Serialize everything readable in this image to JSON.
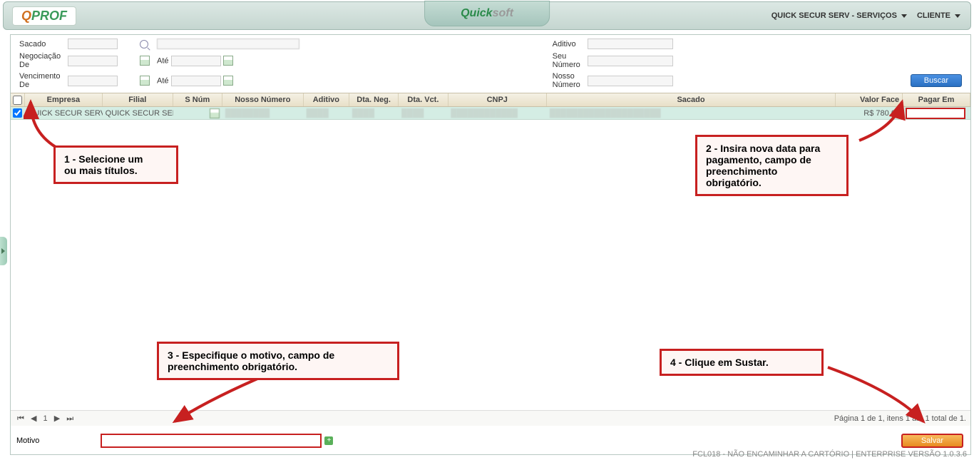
{
  "header": {
    "logo_q": "Q",
    "logo_prof": "PROF",
    "center_1": "Quick",
    "center_2": "soft",
    "right_text": "QUICK SECUR SERV - SERVIÇOS",
    "right_client": "CLIENTE"
  },
  "filters": {
    "sacado": "Sacado",
    "negociacao_de": "Negociação De",
    "vencimento_de": "Vencimento De",
    "ate": "Até",
    "aditivo": "Aditivo",
    "seu_numero": "Seu Número",
    "nosso_numero": "Nosso Número",
    "buscar": "Buscar"
  },
  "grid": {
    "headers": {
      "empresa": "Empresa",
      "filial": "Filial",
      "snum": "S Núm",
      "nosso": "Nosso Número",
      "aditivo": "Aditivo",
      "dta_neg": "Dta. Neg.",
      "dta_vct": "Dta. Vct.",
      "cnpj": "CNPJ",
      "sacado": "Sacado",
      "valor_face": "Valor Face",
      "pagar_em": "Pagar Em"
    },
    "row": {
      "empresa": "QUICK SECUR SERV",
      "filial": "QUICK SECUR SERV",
      "valor": "R$ 780,00"
    }
  },
  "callouts": {
    "c1a": "1 - Selecione um",
    "c1b": "ou mais títulos.",
    "c2a": "2 - Insira nova data para",
    "c2b": "pagamento, campo de",
    "c2c": "preenchimento",
    "c2d": "obrigatório.",
    "c3a": "3 - Especifique o motivo, campo de",
    "c3b": "preenchimento obrigatório.",
    "c4": "4 - Clique em Sustar."
  },
  "pager": {
    "page_num": "1",
    "info": "Página 1 de 1, itens 1 até 1 total de 1."
  },
  "motivo": {
    "label": "Motivo",
    "salvar": "Salvar"
  },
  "footer": "FCL018 - NÃO ENCAMINHAR A CARTÓRIO | ENTERPRISE VERSÃO 1.0.3.6"
}
